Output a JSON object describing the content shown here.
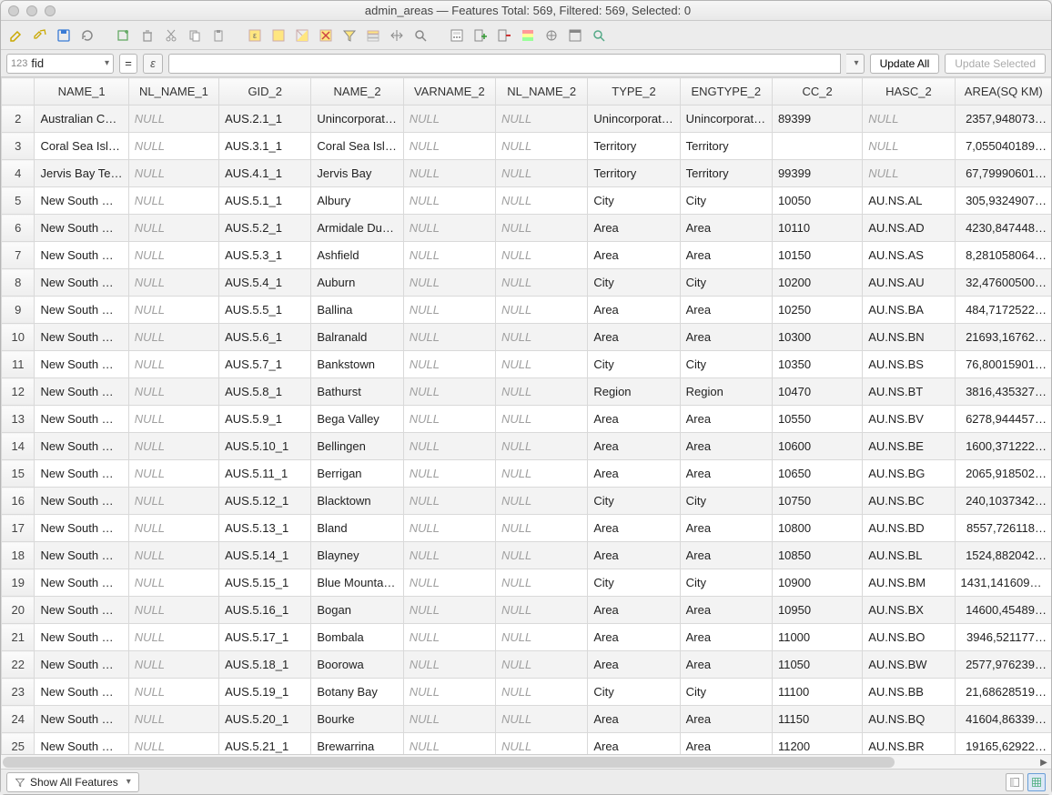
{
  "window": {
    "title": "admin_areas — Features Total: 569, Filtered: 569, Selected: 0"
  },
  "toolbar_icons": [
    "pencil-icon",
    "multi-edit-icon",
    "save-edits-icon",
    "refresh-icon",
    "add-feature-icon",
    "delete-feature-icon",
    "cut-icon",
    "copy-icon",
    "paste-icon",
    "expression-select-icon",
    "select-all-icon",
    "invert-selection-icon",
    "deselect-icon",
    "filter-selection-icon",
    "move-top-icon",
    "pan-to-icon",
    "zoom-to-icon",
    "field-calc-icon",
    "new-field-icon",
    "delete-field-icon",
    "conditional-format-icon",
    "actions-icon",
    "dock-icon",
    "form-view-icon"
  ],
  "filter": {
    "field_prefix": "123",
    "field_name": "fid",
    "eq": "=",
    "eps": "ε",
    "expression": "",
    "update_all": "Update All",
    "update_selected": "Update Selected"
  },
  "columns": [
    "",
    "NAME_1",
    "NL_NAME_1",
    "GID_2",
    "NAME_2",
    "VARNAME_2",
    "NL_NAME_2",
    "TYPE_2",
    "ENGTYPE_2",
    "CC_2",
    "HASC_2",
    "AREA(SQ KM)"
  ],
  "null": "NULL",
  "rows": [
    {
      "n": 2,
      "name1": "Australian Ca…",
      "nl1": null,
      "gid2": "AUS.2.1_1",
      "name2": "Unincorporat…",
      "var2": null,
      "nl2": null,
      "type2": "Unincorporat…",
      "eng2": "Unincorporat…",
      "cc2": "89399",
      "hasc2": null,
      "area": "2357,948073…"
    },
    {
      "n": 3,
      "name1": "Coral Sea Isla…",
      "nl1": null,
      "gid2": "AUS.3.1_1",
      "name2": "Coral Sea Isla…",
      "var2": null,
      "nl2": null,
      "type2": "Territory",
      "eng2": "Territory",
      "cc2": "",
      "hasc2": null,
      "area": "7,055040189…"
    },
    {
      "n": 4,
      "name1": "Jervis Bay Te…",
      "nl1": null,
      "gid2": "AUS.4.1_1",
      "name2": "Jervis Bay",
      "var2": null,
      "nl2": null,
      "type2": "Territory",
      "eng2": "Territory",
      "cc2": "99399",
      "hasc2": null,
      "area": "67,79990601…"
    },
    {
      "n": 5,
      "name1": "New South W…",
      "nl1": null,
      "gid2": "AUS.5.1_1",
      "name2": "Albury",
      "var2": null,
      "nl2": null,
      "type2": "City",
      "eng2": "City",
      "cc2": "10050",
      "hasc2": "AU.NS.AL",
      "area": "305,9324907…"
    },
    {
      "n": 6,
      "name1": "New South W…",
      "nl1": null,
      "gid2": "AUS.5.2_1",
      "name2": "Armidale Du…",
      "var2": null,
      "nl2": null,
      "type2": "Area",
      "eng2": "Area",
      "cc2": "10110",
      "hasc2": "AU.NS.AD",
      "area": "4230,847448…"
    },
    {
      "n": 7,
      "name1": "New South W…",
      "nl1": null,
      "gid2": "AUS.5.3_1",
      "name2": "Ashfield",
      "var2": null,
      "nl2": null,
      "type2": "Area",
      "eng2": "Area",
      "cc2": "10150",
      "hasc2": "AU.NS.AS",
      "area": "8,281058064…"
    },
    {
      "n": 8,
      "name1": "New South W…",
      "nl1": null,
      "gid2": "AUS.5.4_1",
      "name2": "Auburn",
      "var2": null,
      "nl2": null,
      "type2": "City",
      "eng2": "City",
      "cc2": "10200",
      "hasc2": "AU.NS.AU",
      "area": "32,47600500…"
    },
    {
      "n": 9,
      "name1": "New South W…",
      "nl1": null,
      "gid2": "AUS.5.5_1",
      "name2": "Ballina",
      "var2": null,
      "nl2": null,
      "type2": "Area",
      "eng2": "Area",
      "cc2": "10250",
      "hasc2": "AU.NS.BA",
      "area": "484,7172522…"
    },
    {
      "n": 10,
      "name1": "New South W…",
      "nl1": null,
      "gid2": "AUS.5.6_1",
      "name2": "Balranald",
      "var2": null,
      "nl2": null,
      "type2": "Area",
      "eng2": "Area",
      "cc2": "10300",
      "hasc2": "AU.NS.BN",
      "area": "21693,16762…"
    },
    {
      "n": 11,
      "name1": "New South W…",
      "nl1": null,
      "gid2": "AUS.5.7_1",
      "name2": "Bankstown",
      "var2": null,
      "nl2": null,
      "type2": "City",
      "eng2": "City",
      "cc2": "10350",
      "hasc2": "AU.NS.BS",
      "area": "76,80015901…"
    },
    {
      "n": 12,
      "name1": "New South W…",
      "nl1": null,
      "gid2": "AUS.5.8_1",
      "name2": "Bathurst",
      "var2": null,
      "nl2": null,
      "type2": "Region",
      "eng2": "Region",
      "cc2": "10470",
      "hasc2": "AU.NS.BT",
      "area": "3816,435327…"
    },
    {
      "n": 13,
      "name1": "New South W…",
      "nl1": null,
      "gid2": "AUS.5.9_1",
      "name2": "Bega Valley",
      "var2": null,
      "nl2": null,
      "type2": "Area",
      "eng2": "Area",
      "cc2": "10550",
      "hasc2": "AU.NS.BV",
      "area": "6278,944457…"
    },
    {
      "n": 14,
      "name1": "New South W…",
      "nl1": null,
      "gid2": "AUS.5.10_1",
      "name2": "Bellingen",
      "var2": null,
      "nl2": null,
      "type2": "Area",
      "eng2": "Area",
      "cc2": "10600",
      "hasc2": "AU.NS.BE",
      "area": "1600,371222…"
    },
    {
      "n": 15,
      "name1": "New South W…",
      "nl1": null,
      "gid2": "AUS.5.11_1",
      "name2": "Berrigan",
      "var2": null,
      "nl2": null,
      "type2": "Area",
      "eng2": "Area",
      "cc2": "10650",
      "hasc2": "AU.NS.BG",
      "area": "2065,918502…"
    },
    {
      "n": 16,
      "name1": "New South W…",
      "nl1": null,
      "gid2": "AUS.5.12_1",
      "name2": "Blacktown",
      "var2": null,
      "nl2": null,
      "type2": "City",
      "eng2": "City",
      "cc2": "10750",
      "hasc2": "AU.NS.BC",
      "area": "240,1037342…"
    },
    {
      "n": 17,
      "name1": "New South W…",
      "nl1": null,
      "gid2": "AUS.5.13_1",
      "name2": "Bland",
      "var2": null,
      "nl2": null,
      "type2": "Area",
      "eng2": "Area",
      "cc2": "10800",
      "hasc2": "AU.NS.BD",
      "area": "8557,726118…"
    },
    {
      "n": 18,
      "name1": "New South W…",
      "nl1": null,
      "gid2": "AUS.5.14_1",
      "name2": "Blayney",
      "var2": null,
      "nl2": null,
      "type2": "Area",
      "eng2": "Area",
      "cc2": "10850",
      "hasc2": "AU.NS.BL",
      "area": "1524,882042…"
    },
    {
      "n": 19,
      "name1": "New South W…",
      "nl1": null,
      "gid2": "AUS.5.15_1",
      "name2": "Blue Mountains",
      "var2": null,
      "nl2": null,
      "type2": "City",
      "eng2": "City",
      "cc2": "10900",
      "hasc2": "AU.NS.BM",
      "area": "1431,1416092…"
    },
    {
      "n": 20,
      "name1": "New South W…",
      "nl1": null,
      "gid2": "AUS.5.16_1",
      "name2": "Bogan",
      "var2": null,
      "nl2": null,
      "type2": "Area",
      "eng2": "Area",
      "cc2": "10950",
      "hasc2": "AU.NS.BX",
      "area": "14600,45489…"
    },
    {
      "n": 21,
      "name1": "New South W…",
      "nl1": null,
      "gid2": "AUS.5.17_1",
      "name2": "Bombala",
      "var2": null,
      "nl2": null,
      "type2": "Area",
      "eng2": "Area",
      "cc2": "11000",
      "hasc2": "AU.NS.BO",
      "area": "3946,521177…"
    },
    {
      "n": 22,
      "name1": "New South W…",
      "nl1": null,
      "gid2": "AUS.5.18_1",
      "name2": "Boorowa",
      "var2": null,
      "nl2": null,
      "type2": "Area",
      "eng2": "Area",
      "cc2": "11050",
      "hasc2": "AU.NS.BW",
      "area": "2577,976239…"
    },
    {
      "n": 23,
      "name1": "New South W…",
      "nl1": null,
      "gid2": "AUS.5.19_1",
      "name2": "Botany Bay",
      "var2": null,
      "nl2": null,
      "type2": "City",
      "eng2": "City",
      "cc2": "11100",
      "hasc2": "AU.NS.BB",
      "area": "21,68628519…"
    },
    {
      "n": 24,
      "name1": "New South W…",
      "nl1": null,
      "gid2": "AUS.5.20_1",
      "name2": "Bourke",
      "var2": null,
      "nl2": null,
      "type2": "Area",
      "eng2": "Area",
      "cc2": "11150",
      "hasc2": "AU.NS.BQ",
      "area": "41604,86339…"
    },
    {
      "n": 25,
      "name1": "New South W…",
      "nl1": null,
      "gid2": "AUS.5.21_1",
      "name2": "Brewarrina",
      "var2": null,
      "nl2": null,
      "type2": "Area",
      "eng2": "Area",
      "cc2": "11200",
      "hasc2": "AU.NS.BR",
      "area": "19165,62922…"
    }
  ],
  "status": {
    "show_all": "Show All Features"
  }
}
